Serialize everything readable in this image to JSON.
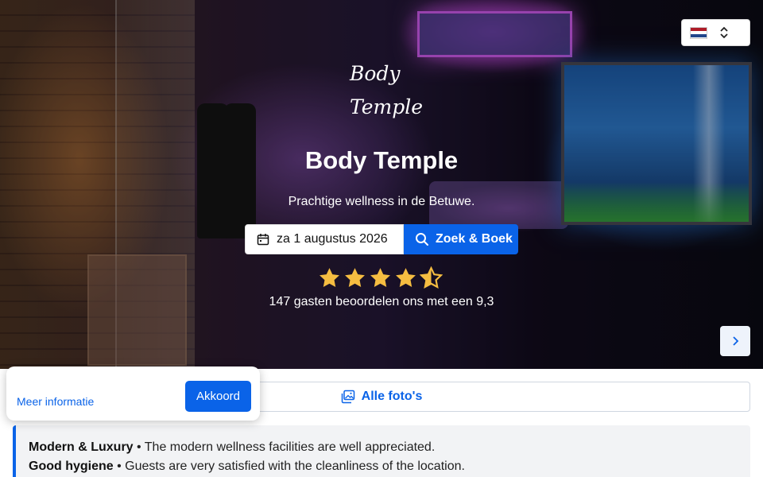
{
  "language": {
    "selected_flag": "flag-netherlands-icon",
    "selector_icon": "chevron-up-down-icon"
  },
  "hero": {
    "logo_line1": "Body",
    "logo_line2": "Temple",
    "title": "Body Temple",
    "subtitle": "Prachtige wellness in de Betuwe.",
    "date_label": "za 1 augustus 2026",
    "book_label": "Zoek & Boek",
    "rating": 4.5,
    "rating_max": 5,
    "rating_text": "147 gasten beoordelen ons met een 9,3"
  },
  "photos": {
    "label": "Alle foto's"
  },
  "highlights": [
    {
      "title": "Modern & Luxury",
      "text": " • The modern wellness facilities are well appreciated."
    },
    {
      "title": "Good hygiene",
      "text": " • Guests are very satisfied with the cleanliness of the location."
    }
  ],
  "cookie": {
    "more_label": "Meer informatie",
    "accept_label": "Akkoord"
  },
  "colors": {
    "accent": "#0a63e8",
    "star": "#f5bd41"
  }
}
